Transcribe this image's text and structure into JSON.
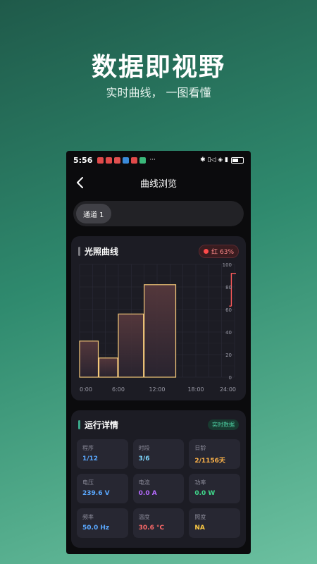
{
  "promo": {
    "title": "数据即视野",
    "subtitle": "实时曲线， 一图看懂"
  },
  "status": {
    "time": "5:56",
    "more": "···",
    "right_icons": "✱ ▯◁ ◈ ▮",
    "dot_colors": [
      "#e04a4a",
      "#e04a4a",
      "#e05050",
      "#3a8ad8",
      "#e04a4a",
      "#3ab87a"
    ]
  },
  "nav": {
    "title": "曲线浏览"
  },
  "channels": [
    {
      "label": "通道 1",
      "selected": true
    }
  ],
  "chart_card": {
    "title": "光照曲线",
    "legend_label": "红 63%",
    "legend_color": "#ff4b4b"
  },
  "chart_data": {
    "type": "bar",
    "series": [
      {
        "name": "红",
        "percent": 63
      }
    ],
    "bars": [
      {
        "start": 0,
        "end": 3,
        "value": 32
      },
      {
        "start": 3,
        "end": 6,
        "value": 17
      },
      {
        "start": 6,
        "end": 10,
        "value": 56
      },
      {
        "start": 10,
        "end": 15,
        "value": 82
      },
      {
        "start": 15,
        "end": 24,
        "value": 0
      }
    ],
    "red_level": {
      "start": 23.5,
      "value": 63,
      "peak": 92
    },
    "x_ticks": [
      "0:00",
      "6:00",
      "12:00",
      "18:00",
      "24:00"
    ],
    "x_tick_values": [
      0,
      6,
      12,
      18,
      24
    ],
    "y_ticks": [
      "0",
      "20",
      "40",
      "60",
      "80",
      "100"
    ],
    "y_tick_values": [
      0,
      20,
      40,
      60,
      80,
      100
    ],
    "xlim": [
      0,
      24
    ],
    "ylim": [
      0,
      100
    ],
    "grid": true,
    "bar_color": "#f5c97a",
    "red_color": "#ff5a5a"
  },
  "ops_card": {
    "title": "运行详情",
    "badge": "实时数据",
    "tiles": [
      {
        "label": "程序",
        "value": "1/12",
        "color": "#5aa8ff"
      },
      {
        "label": "时段",
        "value": "3/6",
        "color": "#7fd8ff"
      },
      {
        "label": "日龄",
        "value": "2/1156天",
        "color": "#ffb44a"
      },
      {
        "label": "电压",
        "value": "239.6 V",
        "color": "#5aa8ff"
      },
      {
        "label": "电流",
        "value": "0.0 A",
        "color": "#b66bff"
      },
      {
        "label": "功率",
        "value": "0.0 W",
        "color": "#3fd68a"
      },
      {
        "label": "频率",
        "value": "50.0 Hz",
        "color": "#5aa8ff"
      },
      {
        "label": "温度",
        "value": "30.6 °C",
        "color": "#ff6a6a"
      },
      {
        "label": "照度",
        "value": "NA",
        "color": "#ffcc44"
      }
    ]
  }
}
